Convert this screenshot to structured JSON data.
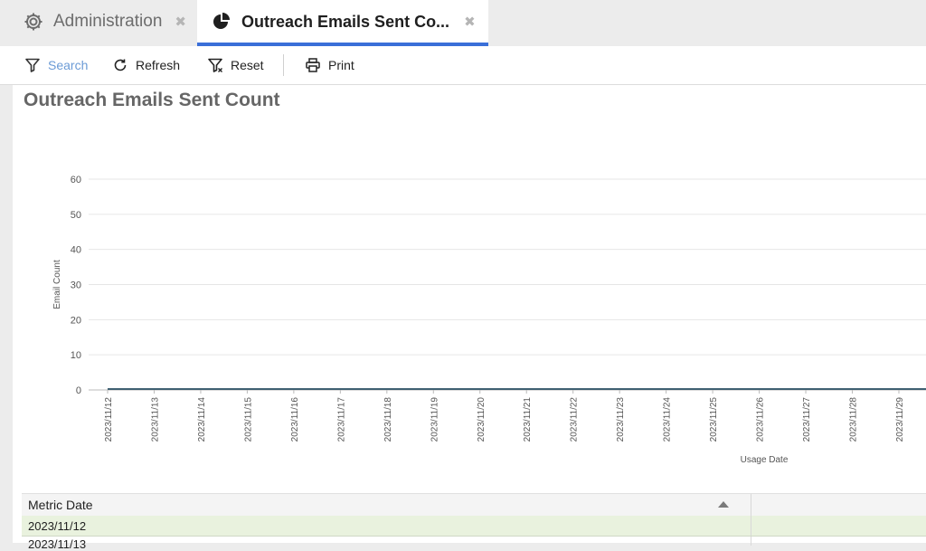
{
  "tabs": [
    {
      "label": "Administration",
      "icon": "gear-icon"
    },
    {
      "label": "Outreach Emails Sent Co...",
      "icon": "pie-chart-icon",
      "active": true,
      "accent": "#3a6fd8"
    }
  ],
  "toolbar": {
    "search_label": "Search",
    "refresh_label": "Refresh",
    "reset_label": "Reset",
    "print_label": "Print"
  },
  "report": {
    "title": "Outreach Emails Sent Count"
  },
  "chart_data": {
    "type": "line",
    "xlabel": "Usage Date",
    "ylabel": "Email Count",
    "ylim": [
      0,
      60
    ],
    "yticks": [
      0,
      10,
      20,
      30,
      40,
      50,
      60
    ],
    "categories": [
      "2023/11/12",
      "2023/11/13",
      "2023/11/14",
      "2023/11/15",
      "2023/11/16",
      "2023/11/17",
      "2023/11/18",
      "2023/11/19",
      "2023/11/20",
      "2023/11/21",
      "2023/11/22",
      "2023/11/23",
      "2023/11/24",
      "2023/11/25",
      "2023/11/26",
      "2023/11/27",
      "2023/11/28",
      "2023/11/29"
    ],
    "series": [
      {
        "values": [
          0,
          0,
          0,
          0,
          0,
          0,
          0,
          0,
          0,
          0,
          0,
          0,
          0,
          0,
          0,
          0,
          0,
          0
        ],
        "color": "#3f6072"
      }
    ],
    "grid": true
  },
  "grid": {
    "column_header": "Metric Date",
    "rows": [
      "2023/11/12",
      "2023/11/13"
    ]
  }
}
